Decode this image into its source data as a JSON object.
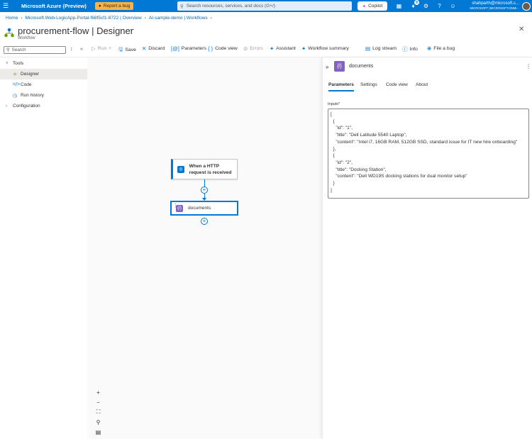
{
  "topbar": {
    "brand": "Microsoft Azure (Preview)",
    "report_bug": "Report a bug",
    "search_placeholder": "Search resources, services, and docs (G+/)",
    "copilot": "Copilot",
    "notification_count": "9",
    "user_email": "shahparth@microsoft.c...",
    "user_tenant": "MICROSOFT (MICROSOFT.ONMI..."
  },
  "breadcrumb": [
    "Home",
    "Microsoft.Web-LogicApp-Portal-f68f5cf1-8722 | Overview",
    "AI-sample-demo | Workflows"
  ],
  "page": {
    "title": "procurement-flow",
    "title_suffix": "Designer",
    "subtitle": "Workflow"
  },
  "sidebar": {
    "search_placeholder": "Search",
    "items": [
      {
        "label": "Tools",
        "level": 0,
        "expanded": true
      },
      {
        "label": "Designer",
        "level": 1,
        "selected": true
      },
      {
        "label": "Code",
        "level": 1
      },
      {
        "label": "Run history",
        "level": 1
      },
      {
        "label": "Configuration",
        "level": 0,
        "expanded": false
      }
    ]
  },
  "toolbar": {
    "run": "Run",
    "save": "Save",
    "discard": "Discard",
    "parameters": "Parameters",
    "code_view": "Code view",
    "errors": "Errors",
    "assistant": "Assistant",
    "workflow_summary": "Workflow summary",
    "log_stream": "Log stream",
    "info": "Info",
    "file_bug": "File a bug"
  },
  "canvas": {
    "trigger_label": "When a HTTP request is received",
    "action_label": "documents"
  },
  "panel": {
    "title": "documents",
    "tabs": [
      "Parameters",
      "Settings",
      "Code view",
      "About"
    ],
    "active_tab": "Parameters",
    "inputs_label": "Inputs",
    "inputs_value": "[\n  {\n    \"id\": \"1\",\n    \"title\": \"Dell Latitude 5540 Laptop\",\n    \"content\": \"Intel i7, 16GB RAM, 512GB SSD, standard issue for IT new hire onboarding\"\n  },\n  {\n    \"id\": \"2\",\n    \"title\": \"Docking Station\",\n    \"content\": \"Dell WD19S docking stations for dual monitor setup\"\n  }\n]"
  },
  "colors": {
    "brand_blue": "#0078d4",
    "bug_orange": "#f7b34b",
    "compose_purple": "#8661c5"
  }
}
